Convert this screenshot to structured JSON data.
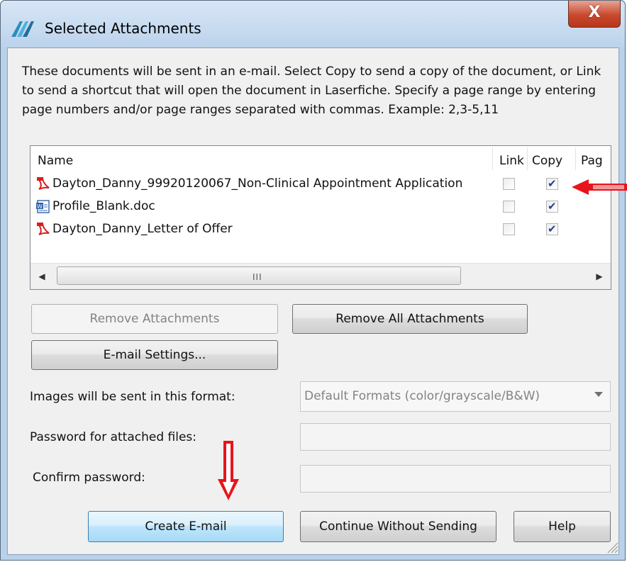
{
  "window": {
    "title": "Selected Attachments",
    "close_label": "X"
  },
  "description": "These documents will be sent in an e-mail. Select Copy to send a copy of the document, or Link to send a shortcut that will open the document in Laserfiche.  Specify a page range by entering page numbers and/or page ranges separated with commas.  Example: 2,3-5,11",
  "attachments": {
    "columns": [
      "Name",
      "Link",
      "Copy",
      "Pag"
    ],
    "rows": [
      {
        "icon": "pdf-icon",
        "name": "Dayton_Danny_99920120067_Non-Clinical Appointment Application",
        "link": false,
        "copy": true
      },
      {
        "icon": "word-doc-icon",
        "name": "Profile_Blank.doc",
        "link": false,
        "copy": true
      },
      {
        "icon": "pdf-icon",
        "name": "Dayton_Danny_Letter of Offer",
        "link": false,
        "copy": true
      }
    ],
    "scrollbar_grip": "III"
  },
  "buttons": {
    "remove_attachments": "Remove Attachments",
    "remove_all_attachments": "Remove All Attachments",
    "email_settings": "E-mail Settings...",
    "create_email": "Create E-mail",
    "continue_without_sending": "Continue Without Sending",
    "help": "Help"
  },
  "form": {
    "image_format_label": "Images will be sent in this format:",
    "image_format_value": "Default Formats (color/grayscale/B&W)",
    "password_label": "Password for attached files:",
    "confirm_password_label": "Confirm password:"
  },
  "colors": {
    "annotation_arrow": "#e8141c",
    "close_button": "#c9492e",
    "checkmark": "#2a3f8f"
  }
}
